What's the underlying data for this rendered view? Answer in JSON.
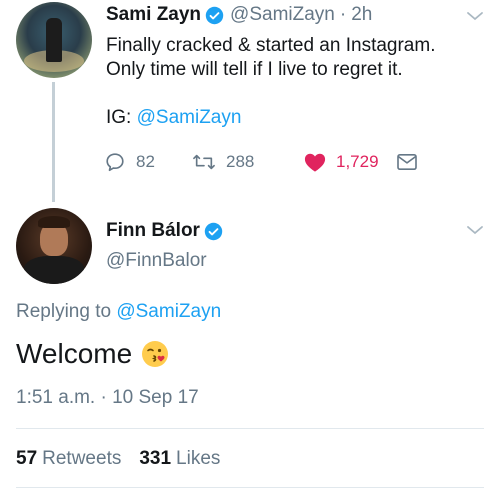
{
  "original_tweet": {
    "name": "Sami Zayn",
    "handle": "@SamiZayn",
    "time": "2h",
    "lines": [
      "Finally cracked & started an Instagram.",
      "Only time will tell if I live to regret it."
    ],
    "ig_prefix": "IG:",
    "ig_link": "@SamiZayn",
    "replies": "82",
    "retweets": "288",
    "likes": "1,729"
  },
  "reply_tweet": {
    "name": "Finn Bálor",
    "handle": "@FinnBalor",
    "replying_prefix": "Replying to",
    "replying_to": "@SamiZayn",
    "text": "Welcome",
    "timestamp": "1:51 a.m. · 10 Sep 17",
    "retweet_count": "57",
    "retweet_label": "Retweets",
    "like_count": "331",
    "like_label": "Likes"
  },
  "colors": {
    "link": "#1da1f2",
    "like": "#e0245e",
    "muted": "#657786"
  },
  "icons": [
    "verified-icon",
    "chevron-down-icon",
    "reply-icon",
    "retweet-icon",
    "heart-icon",
    "dm-icon",
    "kiss-emoji-icon"
  ]
}
